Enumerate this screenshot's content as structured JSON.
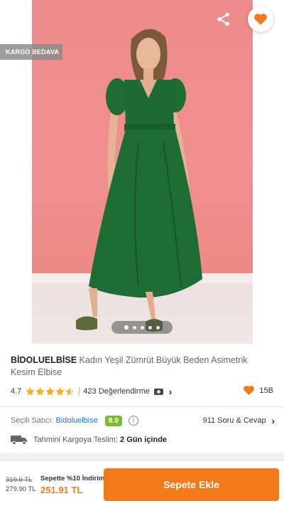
{
  "product": {
    "brand": "BİDOLUELBİSE",
    "title": "Kadın Yeşil Zümrüt Büyük Beden Asimetrik Kesim Elbise",
    "badge": "KARGO BEDAVA",
    "image_count": 5,
    "active_image": 1
  },
  "rating": {
    "score": "4.7",
    "stars": 4.5,
    "reviews": "423 Değerlendirme",
    "favorites": "15B"
  },
  "seller": {
    "label": "Seçili Satıcı:",
    "name": "Bidoluelbise",
    "score": "8.9",
    "qa": "911 Soru & Cevap"
  },
  "shipping": {
    "label": "Tahmini Kargoya Teslim:",
    "value": "2 Gün içinde"
  },
  "price": {
    "old": "319.9 TL",
    "mid": "279.90 TL",
    "promo": "Sepette %10 İndirim",
    "final": "251.91 TL"
  },
  "actions": {
    "add_to_cart": "Sepete Ekle"
  },
  "icons": {
    "back": "arrow-left-icon",
    "share": "share-icon",
    "favorite": "heart-icon",
    "camera": "camera-icon",
    "info": "info-icon",
    "truck": "truck-icon"
  },
  "colors": {
    "accent": "#f27a1a",
    "seller_link": "#1a74d4",
    "score_badge": "#7cbb2b",
    "star": "#f2b21a"
  }
}
